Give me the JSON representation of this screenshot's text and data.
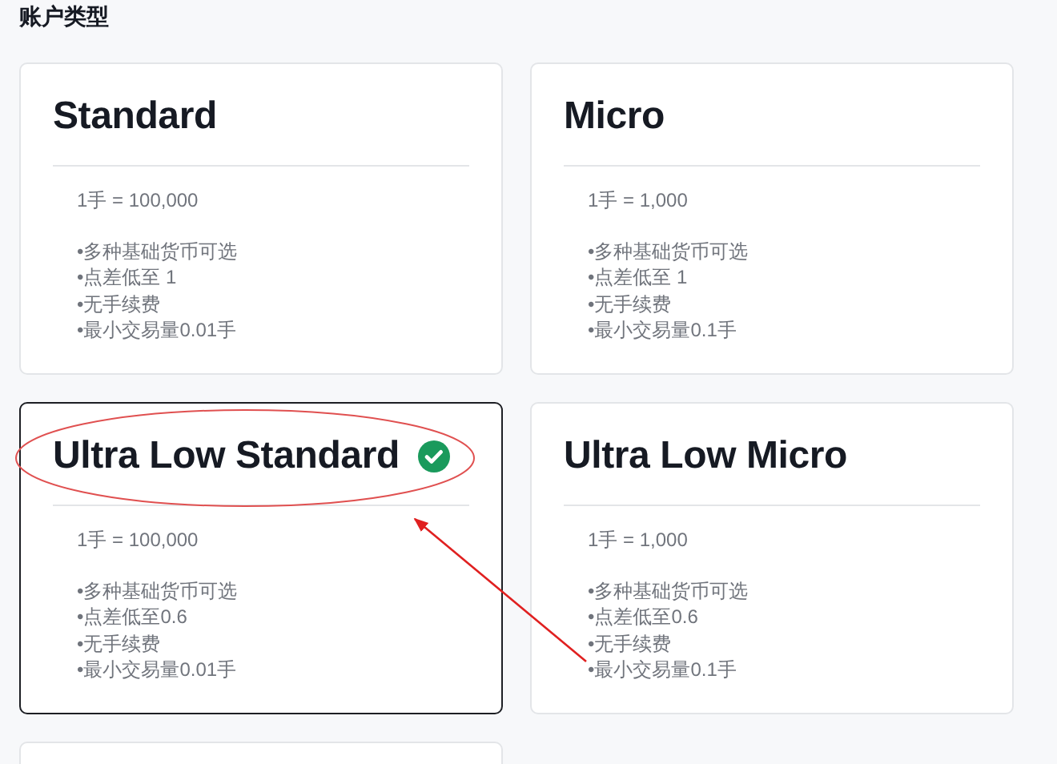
{
  "heading": "账户类型",
  "cards": [
    {
      "kind": "account",
      "title": "Standard",
      "selected": false,
      "lot": "1手 = 100,000",
      "features": [
        "•多种基础货币可选",
        "•点差低至 1",
        "•无手续费",
        "•最小交易量0.01手"
      ]
    },
    {
      "kind": "account",
      "title": "Micro",
      "selected": false,
      "lot": "1手 = 1,000",
      "features": [
        "•多种基础货币可选",
        "•点差低至 1",
        "•无手续费",
        "•最小交易量0.1手"
      ]
    },
    {
      "kind": "account",
      "title": "Ultra Low Standard",
      "selected": true,
      "lot": "1手 = 100,000",
      "features": [
        "•多种基础货币可选",
        "•点差低至0.6",
        "•无手续费",
        "•最小交易量0.01手"
      ]
    },
    {
      "kind": "account",
      "title": "Ultra Low Micro",
      "selected": false,
      "lot": "1手 = 1,000",
      "features": [
        "•多种基础货币可选",
        "•点差低至0.6",
        "•无手续费",
        "•最小交易量0.1手"
      ]
    },
    {
      "kind": "cut_off"
    }
  ],
  "annotations": {
    "title_circled": true,
    "arrow_shown": true
  }
}
